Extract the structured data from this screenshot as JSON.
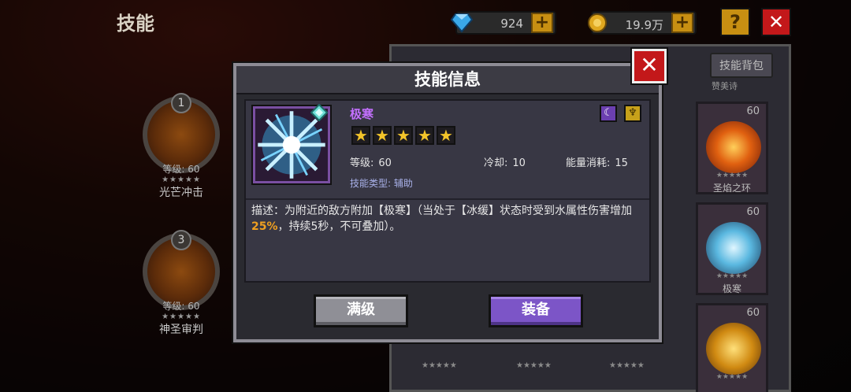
{
  "page": {
    "title": "技能"
  },
  "currency": {
    "gems": "924",
    "gold": "19.9万"
  },
  "top_buttons": {
    "help": "?",
    "close": "✕"
  },
  "left_skills": [
    {
      "slot": "1",
      "level": "等级: 60",
      "stars": "★★★★★",
      "name": "光芒冲击"
    },
    {
      "slot": "3",
      "level": "等级: 60",
      "stars": "★★★★★",
      "name": "神圣审判"
    }
  ],
  "inventory": {
    "tab_label": "技能背包",
    "partial_label": "赞美诗",
    "cards": [
      {
        "level": "60",
        "stars": "★★★★★",
        "name": "圣焰之环"
      },
      {
        "level": "60",
        "stars": "★★★★★",
        "name": "极寒"
      },
      {
        "level": "60",
        "stars": "★★★★★",
        "name": ""
      }
    ],
    "bottom_stars": [
      "★★★★★",
      "★★★★★",
      "★★★★★"
    ]
  },
  "modal": {
    "title": "技能信息",
    "close": "✕",
    "skill": {
      "name": "极寒",
      "stars": [
        "★",
        "★",
        "★",
        "★",
        "★"
      ],
      "level_label": "等级:",
      "level_value": "60",
      "cooldown_label": "冷却:",
      "cooldown_value": "10",
      "energy_label": "能量消耗:",
      "energy_value": "15",
      "type": "技能类型: 辅助",
      "description_prefix": "描述：为附近的敌方附加【极寒】（当处于【冰缓】状态时受到水属性伤害增加",
      "description_highlight": "25%",
      "description_suffix": "，持续5秒，不可叠加）。"
    },
    "buttons": {
      "max": "满级",
      "equip": "装备"
    }
  },
  "colors": {
    "skill_name": "#c470ff",
    "highlight": "#f0a020",
    "equip_button": "#7c55c7",
    "close_red": "#c3181a"
  }
}
